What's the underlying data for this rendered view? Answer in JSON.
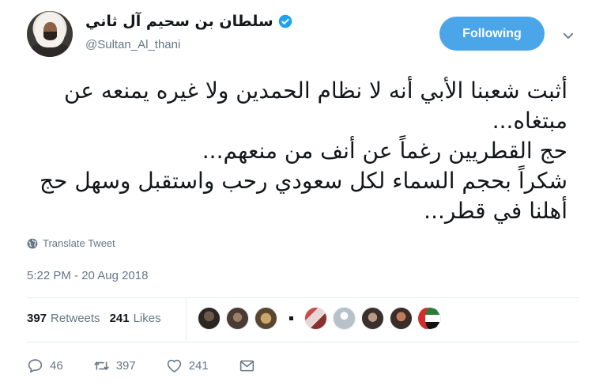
{
  "header": {
    "display_name": "سلطان بن سحيم آل ثاني",
    "handle": "@Sultan_Al_thani",
    "follow_label": "Following"
  },
  "tweet": {
    "text": "أثبت شعبنا الأبي أنه لا نظام الحمدين ولا غيره يمنعه عن مبتغاه...\nحج القطريين رغماً عن أنف من منعهم...\nشكراً بحجم السماء لكل سعودي رحب واستقبل وسهل حج أهلنا في قطر...",
    "translate_label": "Translate Tweet",
    "timestamp": "5:22 PM - 20 Aug 2018"
  },
  "stats": {
    "retweets_count": "397",
    "retweets_label": "Retweets",
    "likes_count": "241",
    "likes_label": "Likes"
  },
  "actions": {
    "reply_count": "46",
    "retweet_count": "397",
    "like_count": "241"
  },
  "colors": {
    "accent": "#4aa6e8",
    "muted": "#657786",
    "text": "#14171a",
    "verified": "#1da1f2"
  },
  "icons": [
    "verified-badge-icon",
    "chevron-down-icon",
    "globe-icon",
    "reply-icon",
    "retweet-icon",
    "heart-icon",
    "mail-icon"
  ]
}
